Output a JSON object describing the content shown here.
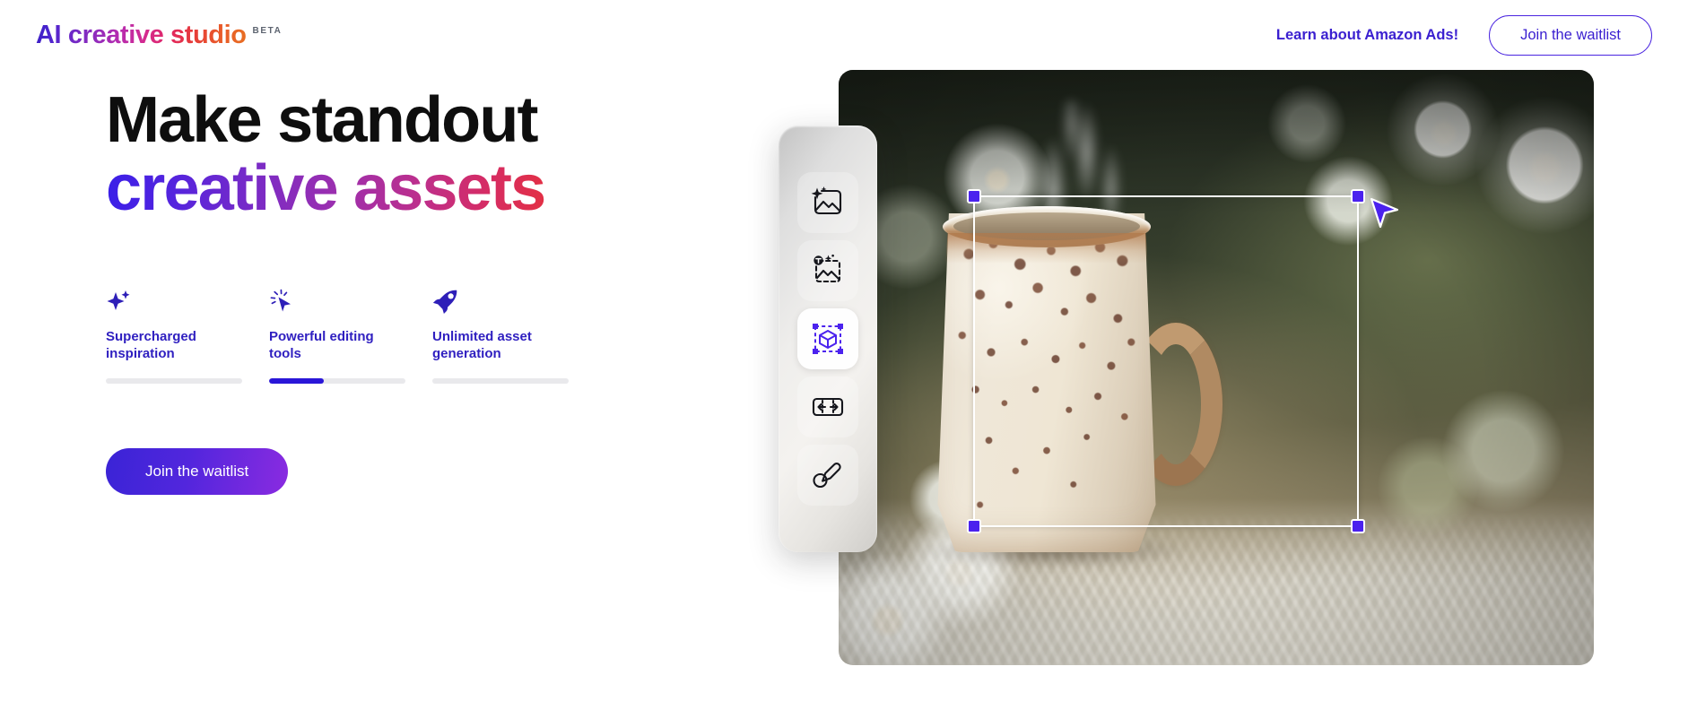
{
  "header": {
    "brand_ai": "AI",
    "brand_rest": " creative studio",
    "beta_badge": "BETA",
    "nav_link": "Learn about Amazon Ads!",
    "cta_label": "Join the waitlist"
  },
  "hero": {
    "headline_line1": "Make standout",
    "headline_line2": "creative assets",
    "cta_label": "Join the waitlist"
  },
  "features": [
    {
      "icon": "sparkle-icon",
      "label": "Supercharged\ninspiration",
      "progress": 0
    },
    {
      "icon": "click-cursor-icon",
      "label": "Powerful editing\ntools",
      "progress": 40
    },
    {
      "icon": "rocket-icon",
      "label": "Unlimited asset\ngeneration",
      "progress": 0
    }
  ],
  "toolbar": {
    "tools": [
      {
        "name": "generate-image-tool",
        "icon": "image-sparkle-icon",
        "active": false
      },
      {
        "name": "text-to-image-tool",
        "icon": "text-image-dashed-icon",
        "active": false
      },
      {
        "name": "object-select-tool",
        "icon": "cube-selection-icon",
        "active": true
      },
      {
        "name": "resize-canvas-tool",
        "icon": "expand-horizontal-icon",
        "active": false
      },
      {
        "name": "retouch-tool",
        "icon": "circle-pencil-icon",
        "active": false
      }
    ]
  },
  "canvas": {
    "image_alt": "Speckled ceramic mug with steam on knit blanket surrounded by daisies",
    "selection_active": true,
    "cursor": "arrow-pointer"
  },
  "colors": {
    "brand_purple": "#3a1fd0",
    "accent_indigo": "#2a16d8",
    "selection_handle": "#4b22ee",
    "selection_border": "#ffffff",
    "progress_track": "#e9e9ec",
    "beta_text": "#5d6470",
    "headline_black": "#0e0e0e"
  }
}
